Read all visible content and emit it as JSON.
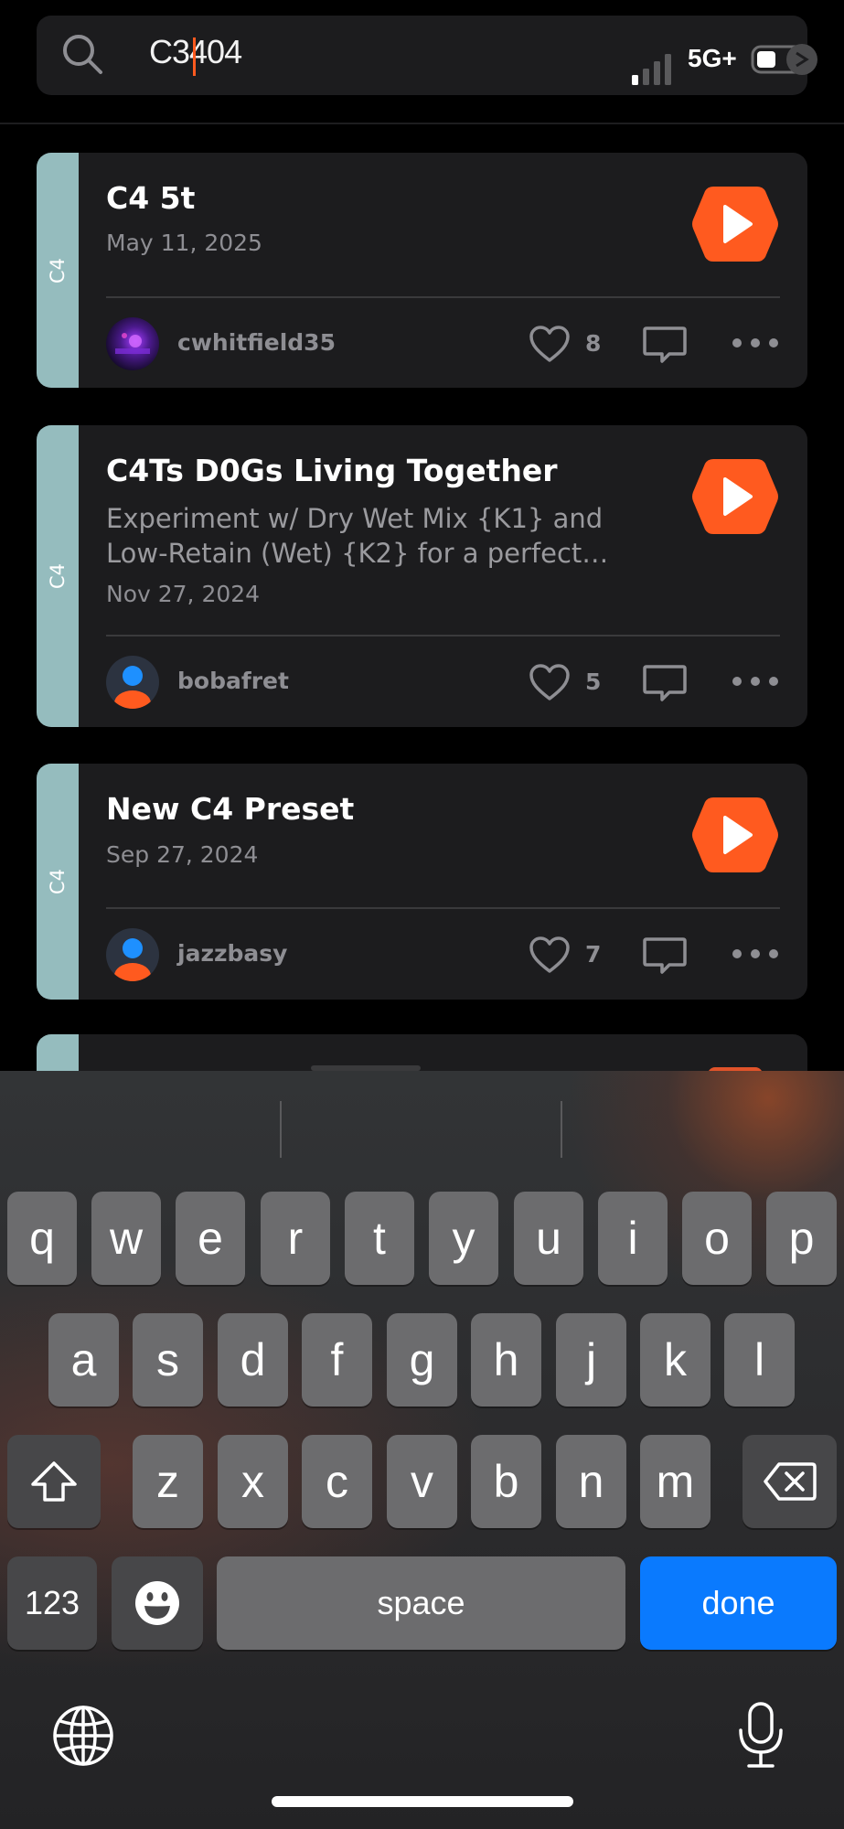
{
  "search": {
    "query": "C3404"
  },
  "status_bar": {
    "network": "5G+"
  },
  "cards": [
    {
      "tag": "C4",
      "title": " C4 5t",
      "description": "",
      "date": "May 11, 2025",
      "username": "cwhitfield35",
      "likes": "8"
    },
    {
      "tag": "C4",
      "title": "C4Ts  D0Gs Living Together",
      "description": "Experiment w/ Dry Wet Mix {K1} and Low-Retain (Wet) {K2} for a perfect…",
      "date": "Nov 27, 2024",
      "username": "bobafret",
      "likes": "5"
    },
    {
      "tag": "C4",
      "title": "New C4 Preset",
      "description": "",
      "date": "Sep 27, 2024",
      "username": "jazzbasy",
      "likes": "7"
    }
  ],
  "keyboard": {
    "row1": [
      "q",
      "w",
      "e",
      "r",
      "t",
      "y",
      "u",
      "i",
      "o",
      "p"
    ],
    "row2": [
      "a",
      "s",
      "d",
      "f",
      "g",
      "h",
      "j",
      "k",
      "l"
    ],
    "row3": [
      "z",
      "x",
      "c",
      "v",
      "b",
      "n",
      "m"
    ],
    "numbers_label": "123",
    "space_label": "space",
    "done_label": "done"
  },
  "colors": {
    "accent": "#ff5a1f",
    "tag": "#95bcbe",
    "done_key": "#0a7afe",
    "card_bg": "#1c1c1e"
  }
}
